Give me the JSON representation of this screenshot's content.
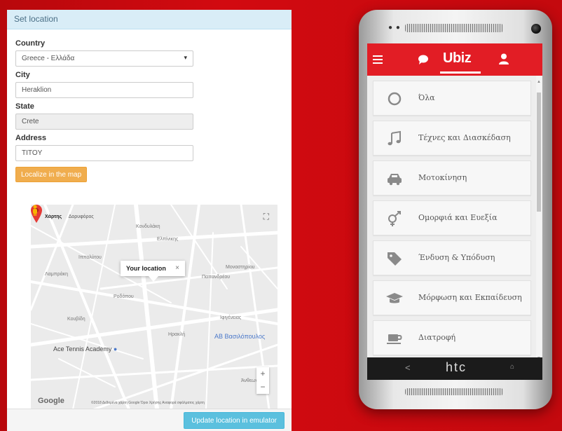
{
  "panel": {
    "title": "Set location",
    "country_label": "Country",
    "country_value": "Greece - Ελλάδα",
    "city_label": "City",
    "city_value": "Heraklion",
    "state_label": "State",
    "state_value": "Crete",
    "address_label": "Address",
    "address_value": "TITOY",
    "localize_button": "Localize in the map",
    "update_button": "Update location in emulator"
  },
  "map": {
    "tab_map": "Χάρτης",
    "tab_satellite": "Δορυφόρος",
    "popup_text": "Your location",
    "popup_close": "×",
    "zoom_in": "+",
    "zoom_out": "−",
    "poi_tennis": "Ace Tennis Academy",
    "poi_ab": "ΑΒ Βασιλόπουλος",
    "street_labels": [
      "Κονδυλάκη",
      "Ελπίνικης",
      "Παπανδρέου",
      "Μοναστηρίου",
      "Ιππολύτου",
      "Ηρακλή",
      "Κουβίδη",
      "Ροδόπου",
      "Λαμπράκη",
      "Ιφιγένειας",
      "Άνθεων"
    ],
    "google_logo": "Google",
    "attribution": "©2018 Δεδομένα χάρτη Google   Όροι Χρήσης   Αναφορά σφάλματος χάρτη"
  },
  "phone": {
    "brand": "htc",
    "app_logo": "Ubiz",
    "nav_back": "<",
    "nav_home": "⌂",
    "categories": [
      {
        "icon": "circle-icon",
        "label": "Όλα"
      },
      {
        "icon": "music-note-icon",
        "label": "Τέχνες και Διασκέδαση"
      },
      {
        "icon": "car-icon",
        "label": "Μοτοκίνηση"
      },
      {
        "icon": "gender-icon",
        "label": "Ομορφιά και Ευεξία"
      },
      {
        "icon": "tag-icon",
        "label": "Ένδυση & Υπόδυση"
      },
      {
        "icon": "graduation-cap-icon",
        "label": "Μόρφωση και Εκπαίδευση"
      },
      {
        "icon": "coffee-cup-icon",
        "label": "Διατροφή"
      }
    ]
  },
  "colors": {
    "background_red": "#c4090e",
    "app_red": "#e21d25",
    "orange_button": "#f0ad4e",
    "blue_button": "#5bc0de",
    "header_blue": "#d9edf7",
    "pin_red": "#e53935"
  }
}
